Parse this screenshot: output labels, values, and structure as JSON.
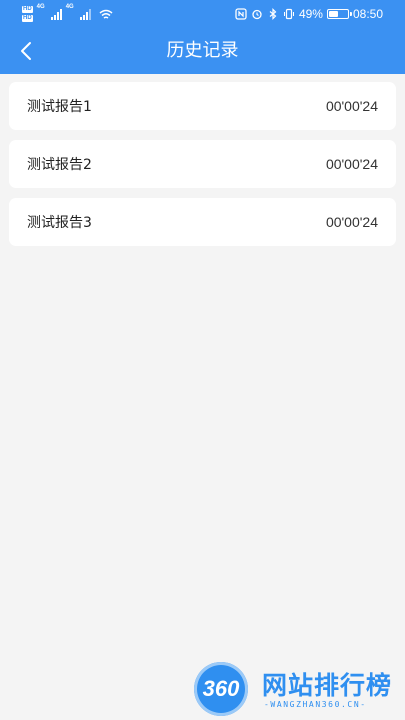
{
  "status_bar": {
    "network_badge_1": "HD",
    "network_badge_2": "HD",
    "signal_1_type": "4G",
    "signal_2_type": "4G",
    "battery_percent": "49%",
    "time": "08:50",
    "battery_level": 0.49,
    "icons": [
      "nfc-icon",
      "alarm-icon",
      "bluetooth-icon",
      "vibrate-icon",
      "battery-icon"
    ]
  },
  "header": {
    "title": "历史记录"
  },
  "records": [
    {
      "name": "测试报告1",
      "duration": "00'00'24"
    },
    {
      "name": "测试报告2",
      "duration": "00'00'24"
    },
    {
      "name": "测试报告3",
      "duration": "00'00'24"
    }
  ],
  "watermark": {
    "logo_text": "360",
    "brand": "网站排行榜",
    "url": "-WANGZHAN360.CN-"
  },
  "colors": {
    "primary": "#3b91f2",
    "background": "#f4f4f4",
    "card": "#ffffff"
  }
}
